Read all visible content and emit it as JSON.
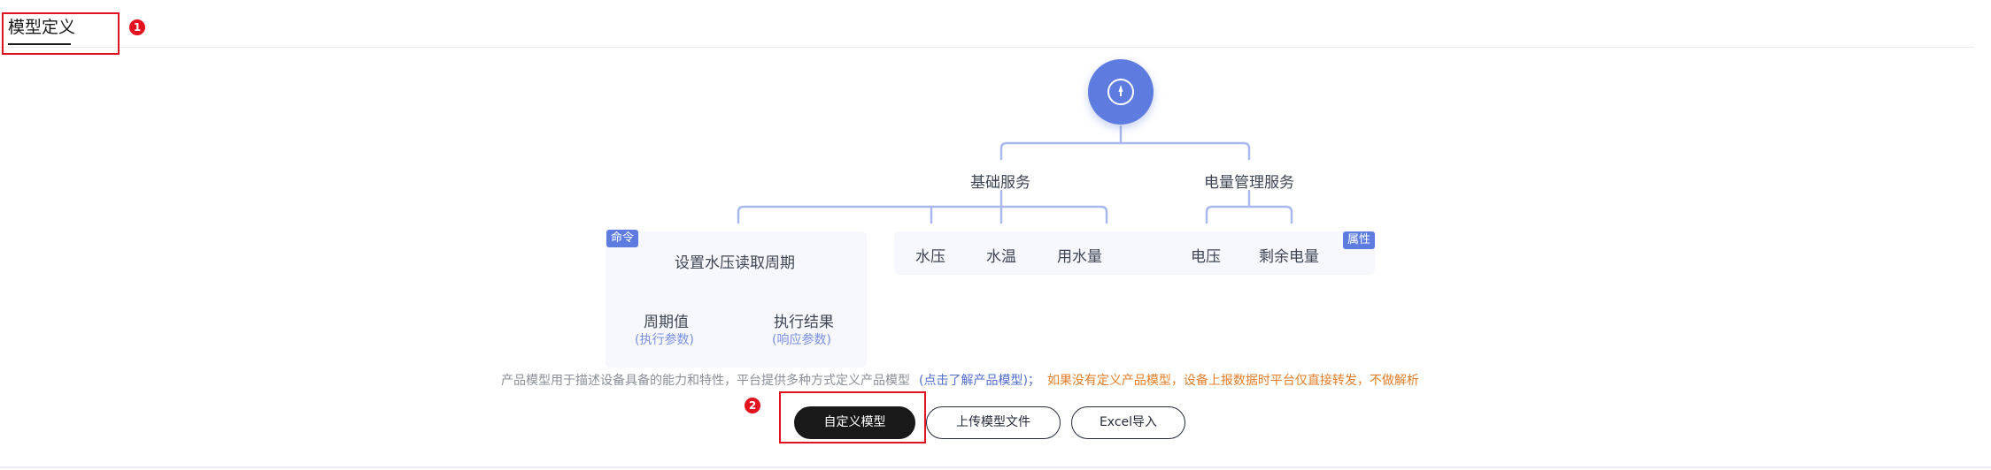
{
  "tabs": [
    {
      "label": "模型定义",
      "active": true
    }
  ],
  "callouts": [
    "1",
    "2"
  ],
  "diagram": {
    "root_icon": "compass-icon",
    "services": [
      {
        "label": "基础服务"
      },
      {
        "label": "电量管理服务"
      }
    ],
    "command_tag": "命令",
    "property_tag": "属性",
    "command": {
      "name": "设置水压读取周期",
      "params": [
        {
          "label": "周期值",
          "sub": "(执行参数)"
        },
        {
          "label": "执行结果",
          "sub": "(响应参数)"
        }
      ]
    },
    "basic_properties": [
      "水压",
      "水温",
      "用水量"
    ],
    "power_properties": [
      "电压",
      "剩余电量"
    ]
  },
  "description": {
    "text": "产品模型用于描述设备具备的能力和特性，平台提供多种方式定义产品模型",
    "link": "(点击了解产品模型)；",
    "warning": "如果没有定义产品模型，设备上报数据时平台仅直接转发，不做解析"
  },
  "buttons": {
    "custom_model": "自定义模型",
    "upload_model_file": "上传模型文件",
    "excel_import": "Excel导入"
  },
  "colors": {
    "accent": "#5e7ce0",
    "highlight": "#e3121f",
    "warning": "#e37d29",
    "link": "#526ecc"
  }
}
